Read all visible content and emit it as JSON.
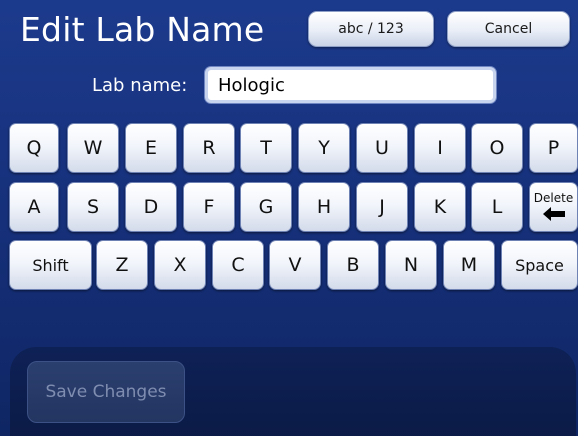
{
  "header": {
    "title": "Edit Lab Name",
    "mode_button_label": "abc / 123",
    "cancel_button_label": "Cancel"
  },
  "form": {
    "lab_name_label": "Lab name:",
    "lab_name_value": "Hologic"
  },
  "keyboard": {
    "row1": [
      "Q",
      "W",
      "E",
      "R",
      "T",
      "Y",
      "U",
      "I",
      "O",
      "P"
    ],
    "row2": [
      "A",
      "S",
      "D",
      "F",
      "G",
      "H",
      "J",
      "K",
      "L"
    ],
    "row3": [
      "Z",
      "X",
      "C",
      "V",
      "B",
      "N",
      "M"
    ],
    "shift_label": "Shift",
    "space_label": "Space",
    "delete_label": "Delete",
    "delete_icon": "left-arrow-icon"
  },
  "footer": {
    "save_button_label": "Save Changes",
    "save_button_enabled": false
  },
  "colors": {
    "background": "#1a378a",
    "key_face": "#f2f5fb",
    "disabled_text": "#7f8db0"
  }
}
